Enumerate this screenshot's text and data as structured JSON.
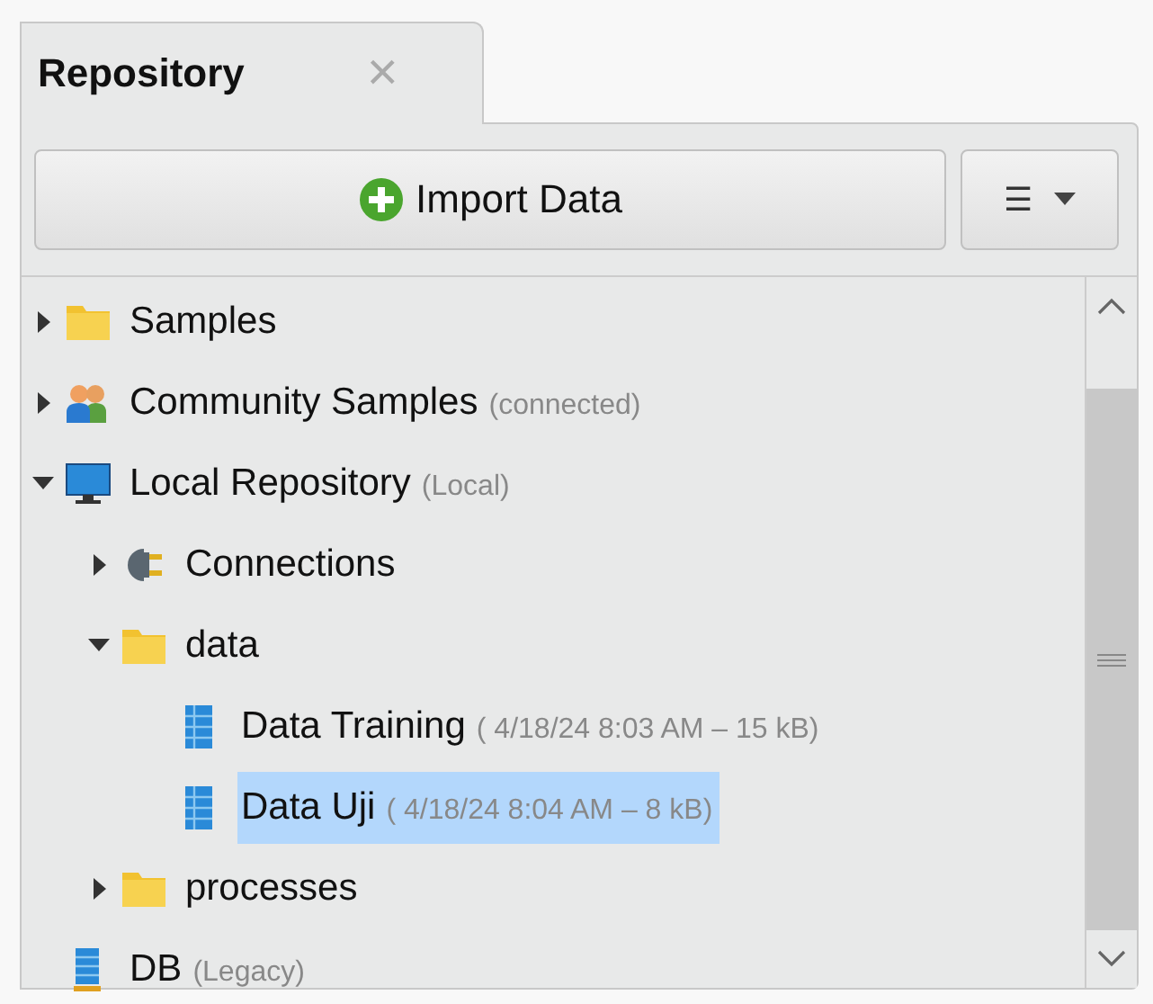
{
  "tabs": [
    {
      "label": "Repository",
      "selected": true,
      "close": "×"
    }
  ],
  "toolbar": {
    "import_button": "Import Data",
    "menu_button": "☰"
  },
  "tree": [
    {
      "kind": "folder",
      "label": "Samples",
      "expanded": false,
      "selected": false
    },
    {
      "kind": "community",
      "label": "Community Samples",
      "note": "(connected)",
      "expanded": false,
      "selected": false
    },
    {
      "kind": "monitor",
      "label": "Local Repository",
      "note": "(Local)",
      "expanded": true,
      "selected": false,
      "children": [
        {
          "kind": "plug",
          "label": "Connections",
          "expanded": false,
          "selected": false
        },
        {
          "kind": "folder",
          "label": "data",
          "expanded": true,
          "selected": false,
          "children": [
            {
              "kind": "table",
              "label": "Data Training",
              "note": "( 4/18/24 8:03 AM – 15 kB)",
              "selected": false
            },
            {
              "kind": "table",
              "label": "Data Uji",
              "note": "( 4/18/24 8:04 AM – 8 kB)",
              "selected": true
            }
          ]
        },
        {
          "kind": "folder",
          "label": "processes",
          "expanded": false,
          "selected": false
        }
      ]
    },
    {
      "kind": "db",
      "label": "DB",
      "note": "(Legacy)",
      "selected": false
    }
  ]
}
